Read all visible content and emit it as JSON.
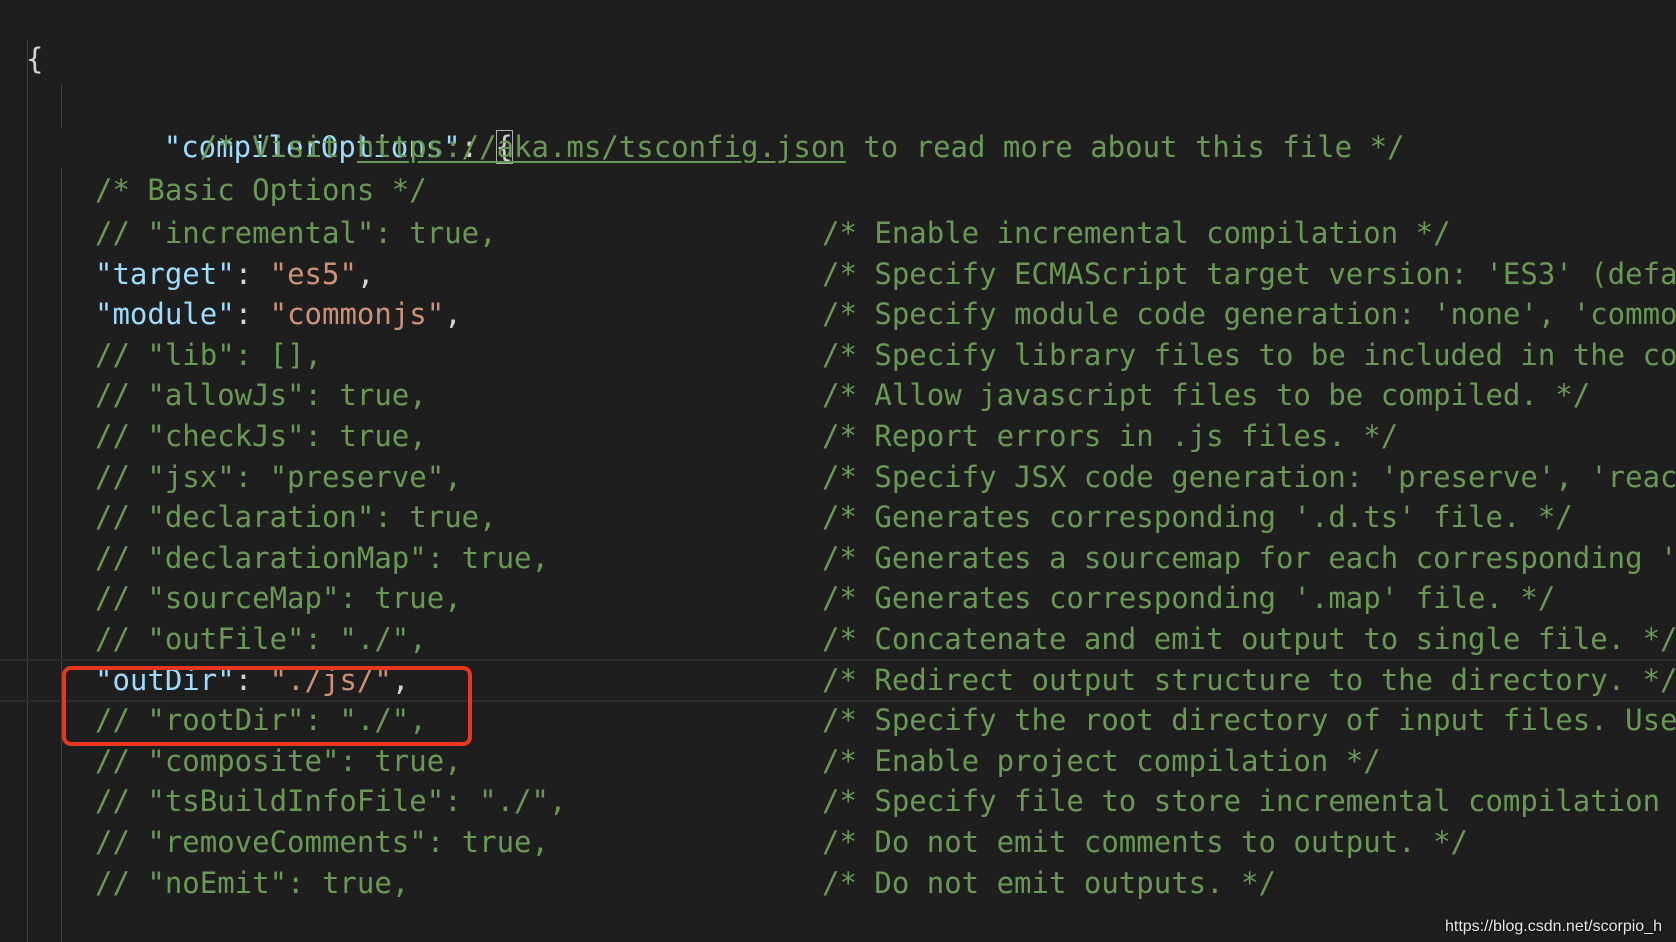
{
  "editor": {
    "brace_open": "{",
    "compiler_options": {
      "key": "\"compilerOptions\"",
      "colon": ": ",
      "bracket": "{"
    },
    "visit_comment": {
      "prefix": "/* Visit ",
      "link": "https://aka.ms/tsconfig.json",
      "suffix": " to read more about this file */"
    },
    "basic_options_comment": "/* Basic Options */",
    "options": [
      {
        "code": "// \"incremental\": true,",
        "comment": "/* Enable incremental compilation */",
        "active": false
      },
      {
        "key": "\"target\"",
        "value": "\"es5\"",
        "comment": "/* Specify ECMAScript target version: 'ES3' (defa",
        "active": true
      },
      {
        "key": "\"module\"",
        "value": "\"commonjs\"",
        "comment": "/* Specify module code generation: 'none', 'commo",
        "active": true
      },
      {
        "code": "// \"lib\": [],",
        "comment": "/* Specify library files to be included in the co",
        "active": false
      },
      {
        "code": "// \"allowJs\": true,",
        "comment": "/* Allow javascript files to be compiled. */",
        "active": false
      },
      {
        "code": "// \"checkJs\": true,",
        "comment": "/* Report errors in .js files. */",
        "active": false
      },
      {
        "code": "// \"jsx\": \"preserve\",",
        "comment": "/* Specify JSX code generation: 'preserve', 'reac",
        "active": false
      },
      {
        "code": "// \"declaration\": true,",
        "comment": "/* Generates corresponding '.d.ts' file. */",
        "active": false
      },
      {
        "code": "// \"declarationMap\": true,",
        "comment": "/* Generates a sourcemap for each corresponding '",
        "active": false
      },
      {
        "code": "// \"sourceMap\": true,",
        "comment": "/* Generates corresponding '.map' file. */",
        "active": false
      },
      {
        "code": "// \"outFile\": \"./\",",
        "comment": "/* Concatenate and emit output to single file. */",
        "active": false
      },
      {
        "key": "\"outDir\"",
        "value": "\"./js/\"",
        "comment": "/* Redirect output structure to the directory. */",
        "active": true,
        "highlighted": true
      },
      {
        "code": "// \"rootDir\": \"./\",",
        "comment": "/* Specify the root directory of input files. Use",
        "active": false
      },
      {
        "code": "// \"composite\": true,",
        "comment": "/* Enable project compilation */",
        "active": false
      },
      {
        "code": "// \"tsBuildInfoFile\": \"./\",",
        "comment": "/* Specify file to store incremental compilation",
        "active": false
      },
      {
        "code": "// \"removeComments\": true,",
        "comment": "/* Do not emit comments to output. */",
        "active": false
      },
      {
        "code": "// \"noEmit\": true,",
        "comment": "/* Do not emit outputs. */",
        "active": false
      }
    ]
  },
  "watermark": "https://blog.csdn.net/scorpio_h",
  "colors": {
    "background": "#1e1e1e",
    "comment": "#6a9955",
    "property": "#9cdcfe",
    "string": "#ce9178",
    "punctuation": "#d4d4d4",
    "highlight_border": "#e8371f"
  }
}
